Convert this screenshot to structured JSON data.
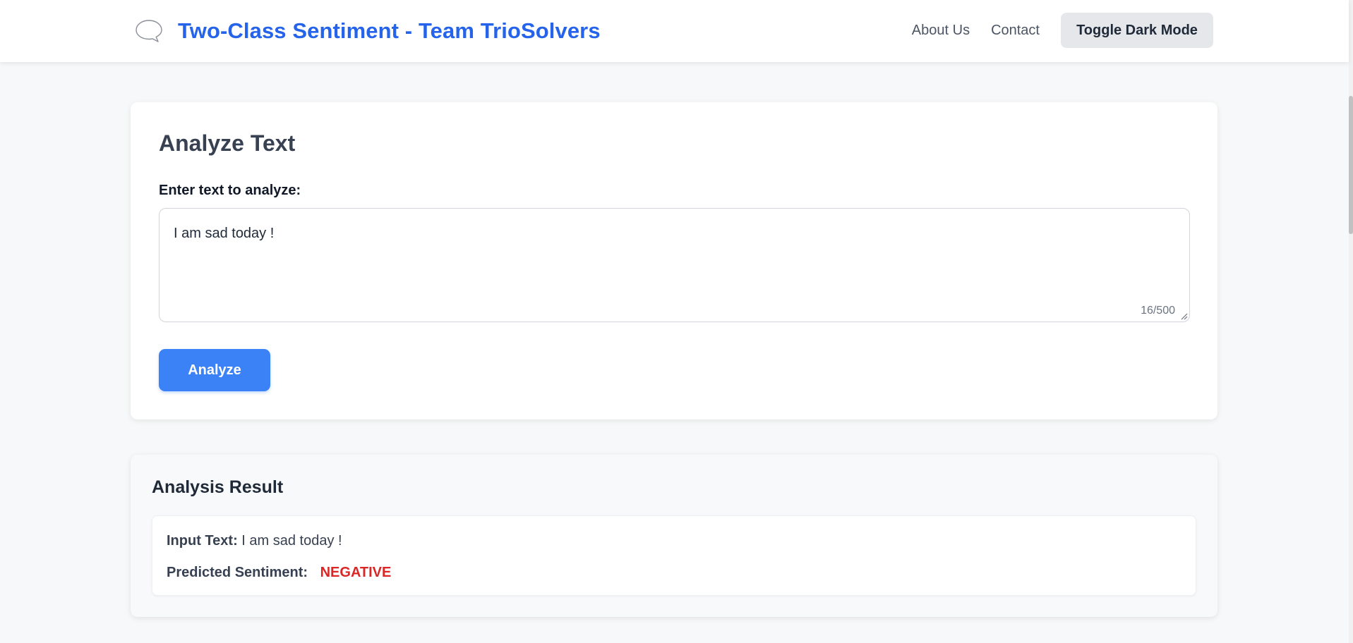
{
  "header": {
    "brand_icon": "speech-bubble-icon",
    "title": "Two-Class Sentiment - Team TrioSolvers",
    "nav": {
      "about": "About Us",
      "contact": "Contact",
      "toggle_dark": "Toggle Dark Mode"
    }
  },
  "analyze": {
    "heading": "Analyze Text",
    "input_label": "Enter text to analyze:",
    "input_value": "I am sad today !",
    "char_count": "16/500",
    "button_label": "Analyze"
  },
  "result": {
    "heading": "Analysis Result",
    "input_label": "Input Text:",
    "input_text": "I am sad today !",
    "sentiment_label": "Predicted Sentiment:",
    "sentiment_value": "NEGATIVE"
  },
  "colors": {
    "brand": "#2563eb",
    "primary_button": "#3b82f6",
    "negative": "#dc2626"
  }
}
